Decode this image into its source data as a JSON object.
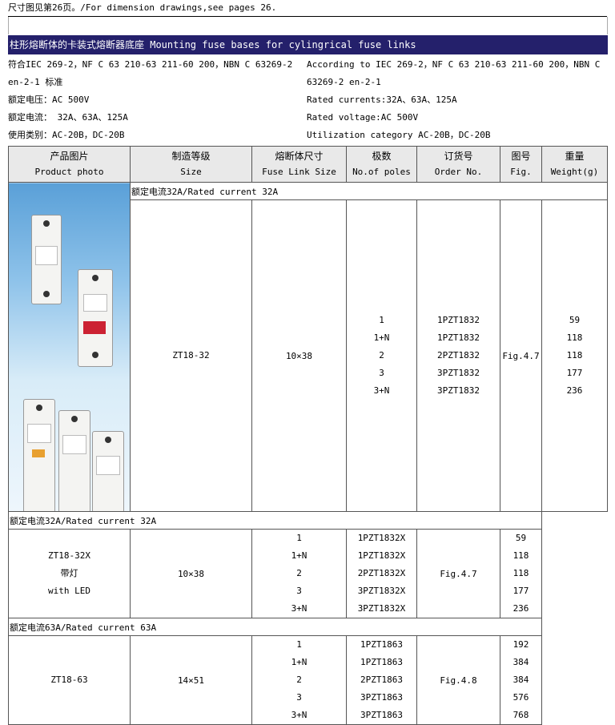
{
  "top_note": "尺寸图见第26页。/For dimension drawings,see pages 26.",
  "section_title": "柱形熔断体的卡装式熔断器底座 Mounting fuse bases for cylingrical fuse links",
  "specs_left": [
    "符合IEC 269-2，NF C 63 210-63 211-60 200，NBN C 63269-2",
    "en-2-1 标准",
    "额定电压：AC 500V",
    "额定电流： 32A、63A、125A",
    "使用类别：AC-20B，DC-20B"
  ],
  "specs_right": [
    "According to IEC 269-2，NF C 63 210-63 211-60 200，NBN C",
    "63269-2 en-2-1",
    "Rated currents:32A、63A、125A",
    "Rated voltage:AC 500V",
    "Utilization category AC-20B，DC-20B"
  ],
  "headers": [
    {
      "cn": "产品图片",
      "en": "Product photo"
    },
    {
      "cn": "制造等级",
      "en": "Size"
    },
    {
      "cn": "熔断体尺寸",
      "en": "Fuse Link Size"
    },
    {
      "cn": "极数",
      "en": "No.of poles"
    },
    {
      "cn": "订货号",
      "en": "Order No."
    },
    {
      "cn": "图号",
      "en": "Fig."
    },
    {
      "cn": "重量",
      "en": "Weight(g)"
    }
  ],
  "groups": [
    {
      "heading": "额定电流32A/Rated current 32A",
      "size_lines": [
        "ZT18-32"
      ],
      "fuse_size": "10×38",
      "fig": "Fig.4.7",
      "poles": [
        "1",
        "1+N",
        "2",
        "3",
        "3+N"
      ],
      "orders": [
        "1PZT1832",
        "1PZT1832",
        "2PZT1832",
        "3PZT1832",
        "3PZT1832"
      ],
      "weights": [
        "59",
        "118",
        "118",
        "177",
        "236"
      ]
    },
    {
      "heading": "额定电流32A/Rated current 32A",
      "size_lines": [
        "ZT18-32X",
        "带灯",
        "with LED"
      ],
      "fuse_size": "10×38",
      "fig": "Fig.4.7",
      "poles": [
        "1",
        "1+N",
        "2",
        "3",
        "3+N"
      ],
      "orders": [
        "1PZT1832X",
        "1PZT1832X",
        "2PZT1832X",
        "3PZT1832X",
        "3PZT1832X"
      ],
      "weights": [
        "59",
        "118",
        "118",
        "177",
        "236"
      ]
    },
    {
      "heading": "额定电流63A/Rated current 63A",
      "size_lines": [
        "ZT18-63"
      ],
      "fuse_size": "14×51",
      "fig": "Fig.4.8",
      "poles": [
        "1",
        "1+N",
        "2",
        "3",
        "3+N"
      ],
      "orders": [
        "1PZT1863",
        "1PZT1863",
        "2PZT1863",
        "3PZT1863",
        "3PZT1863"
      ],
      "weights": [
        "192",
        "384",
        "384",
        "576",
        "768"
      ]
    }
  ]
}
